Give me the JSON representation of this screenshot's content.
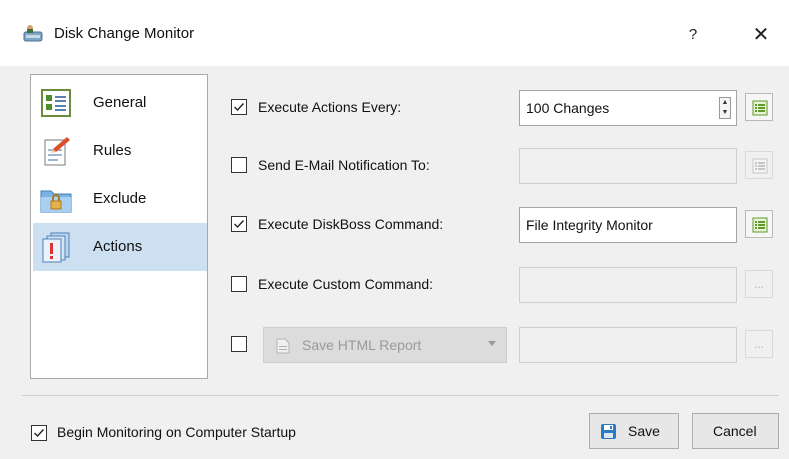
{
  "window": {
    "title": "Disk Change Monitor",
    "help": "?",
    "close": "✕"
  },
  "sidebar": {
    "items": [
      {
        "label": "General",
        "icon": "general-icon",
        "selected": false
      },
      {
        "label": "Rules",
        "icon": "rules-icon",
        "selected": false
      },
      {
        "label": "Exclude",
        "icon": "exclude-icon",
        "selected": false
      },
      {
        "label": "Actions",
        "icon": "actions-icon",
        "selected": true
      }
    ]
  },
  "actions": {
    "execute_every": {
      "checked": true,
      "label": "Execute Actions Every:",
      "value": "100 Changes"
    },
    "email": {
      "checked": false,
      "label": "Send E-Mail Notification To:",
      "value": ""
    },
    "diskboss": {
      "checked": true,
      "label": "Execute DiskBoss Command:",
      "value": "File Integrity Monitor"
    },
    "custom": {
      "checked": false,
      "label": "Execute Custom Command:",
      "value": "",
      "browse": "..."
    },
    "report": {
      "checked": false,
      "type": "Save HTML Report",
      "value": "",
      "browse": "..."
    }
  },
  "footer": {
    "startup_checked": true,
    "startup_label": "Begin Monitoring on Computer Startup",
    "save": "Save",
    "cancel": "Cancel"
  },
  "colors": {
    "selection": "#cce0f2",
    "accent": "#2a7bc2"
  }
}
